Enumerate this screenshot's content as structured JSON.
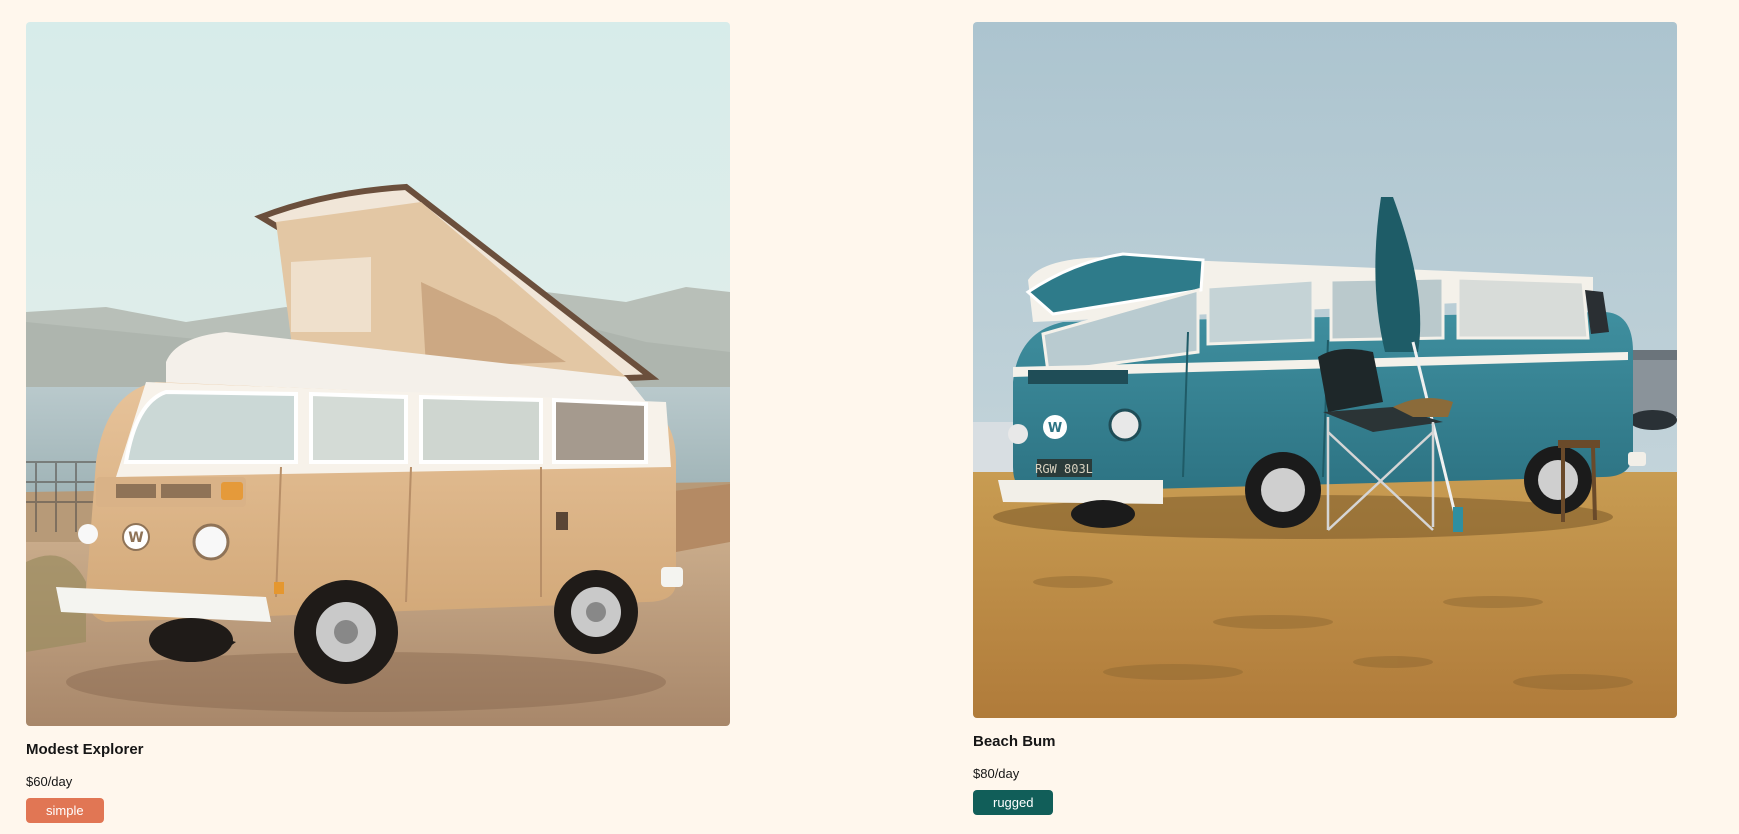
{
  "vans": [
    {
      "name": "Modest Explorer",
      "price": "$60/day",
      "type": "simple",
      "type_color": "#e17654",
      "image_subject": "beige vintage camper van with pop-up roof parked by the sea"
    },
    {
      "name": "Beach Bum",
      "price": "$80/day",
      "type": "rugged",
      "type_color": "#115e59",
      "image_subject": "teal vintage camper van on a grassy field with camping chair and umbrella"
    }
  ]
}
